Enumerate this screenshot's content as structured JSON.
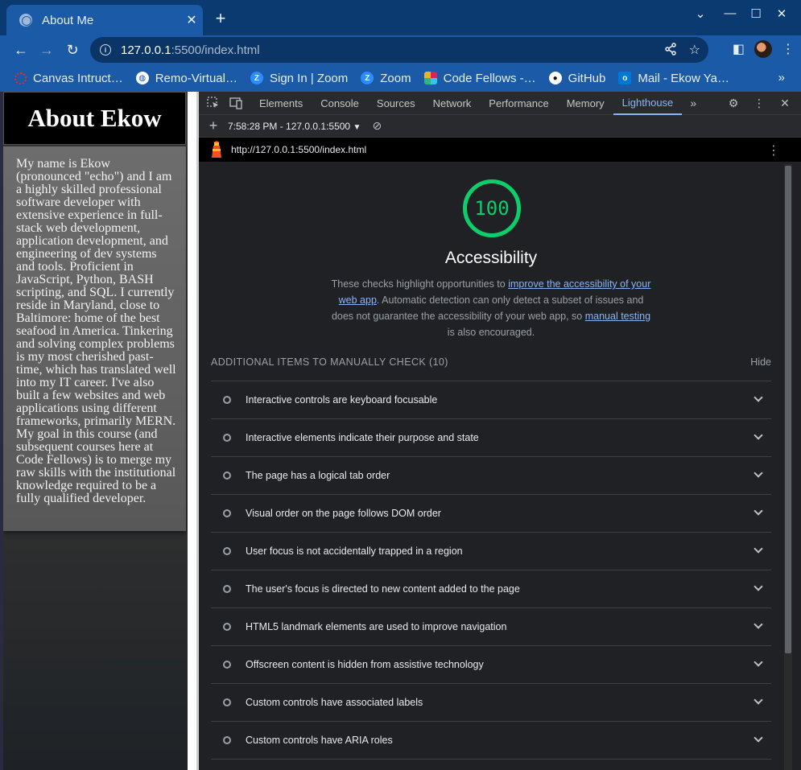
{
  "browser": {
    "tab_title": "About Me",
    "url_host": "127.0.0.1",
    "url_path": ":5500/index.html",
    "bookmarks": [
      {
        "label": "Canvas Intruct…",
        "icon": "canvas-icon",
        "color": "#e0302a"
      },
      {
        "label": "Remo-Virtual…",
        "icon": "globe-icon",
        "color": "#ffffff"
      },
      {
        "label": "Sign In | Zoom",
        "icon": "zoom-icon",
        "color": "#2d8cff"
      },
      {
        "label": "Zoom",
        "icon": "zoom-icon",
        "color": "#2d8cff"
      },
      {
        "label": "Code Fellows -…",
        "icon": "slack-icon",
        "color": "#e01e5a"
      },
      {
        "label": "GitHub",
        "icon": "github-icon",
        "color": "#ffffff"
      },
      {
        "label": "Mail - Ekow Ya…",
        "icon": "outlook-icon",
        "color": "#0078d4"
      }
    ],
    "more_bookmarks": "»"
  },
  "page": {
    "heading": "About Ekow",
    "bio": "My name is Ekow (pronounced \"echo\") and I am a highly skilled professional software developer with extensive experience in full-stack web development, application development, and engineering of dev systems and tools. Proficient in JavaScript, Python, BASH scripting, and SQL. I currently reside in Maryland, close to Baltimore: home of the best seafood in America. Tinkering and solving complex problems is my most cherished past-time, which has translated well into my IT career. I've also built a few websites and web applications using different frameworks, primarily MERN. My goal in this course (and subsequent courses here at Code Fellows) is to merge my raw skills with the institutional knowledge required to be a fully qualified developer."
  },
  "devtools": {
    "tabs": [
      "Elements",
      "Console",
      "Sources",
      "Network",
      "Performance",
      "Memory",
      "Lighthouse"
    ],
    "active_tab": "Lighthouse",
    "report_label": "7:58:28 PM - 127.0.0.1:5500",
    "report_url": "http://127.0.0.1:5500/index.html"
  },
  "lighthouse": {
    "score": "100",
    "category": "Accessibility",
    "desc_1": "These checks highlight opportunities to ",
    "desc_link_1": "improve the accessibility of your web app",
    "desc_2": ". Automatic detection can only detect a subset of issues and does not guarantee the accessibility of your web app, so ",
    "desc_link_2": "manual testing",
    "desc_3": " is also encouraged.",
    "group_title": "ADDITIONAL ITEMS TO MANUALLY CHECK (10)",
    "group_toggle": "Hide",
    "score_color": "#0cce6b",
    "audits": [
      "Interactive controls are keyboard focusable",
      "Interactive elements indicate their purpose and state",
      "The page has a logical tab order",
      "Visual order on the page follows DOM order",
      "User focus is not accidentally trapped in a region",
      "The user's focus is directed to new content added to the page",
      "HTML5 landmark elements are used to improve navigation",
      "Offscreen content is hidden from assistive technology",
      "Custom controls have associated labels",
      "Custom controls have ARIA roles"
    ]
  }
}
